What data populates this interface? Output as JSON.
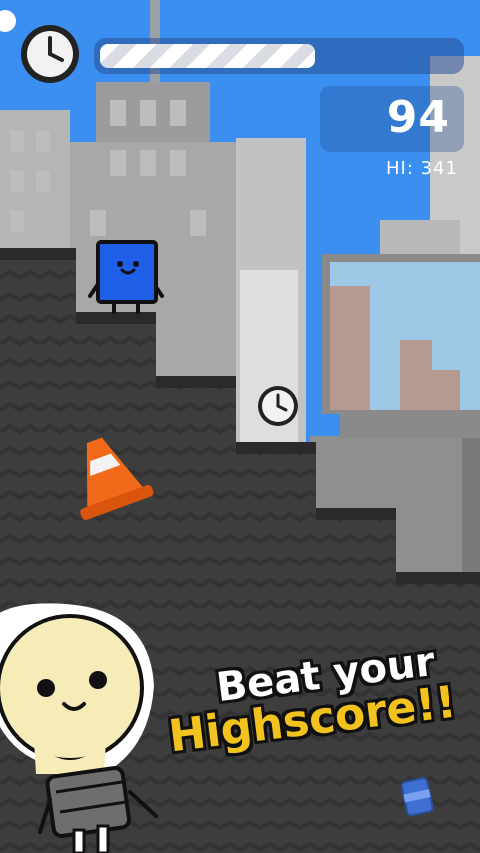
{
  "hud": {
    "score": "94",
    "high_score_label": "HI: 341",
    "timer_remaining_fraction": 0.6
  },
  "promo": {
    "line1": "Beat your",
    "line2": "Highscore!!"
  },
  "colors": {
    "sky": "#3b8ff0",
    "ground": "#3b3b3b",
    "step_edge": "#2a2a2a",
    "player": "#1f5fe8",
    "cone": "#f06a1a",
    "promo_yellow": "#f2c21f"
  },
  "icons": {
    "hud_timer": "clock-icon",
    "pickup": "clock-icon",
    "mascot": "lightbulb-mascot",
    "obstacle": "traffic-cone",
    "item": "soda-can"
  }
}
